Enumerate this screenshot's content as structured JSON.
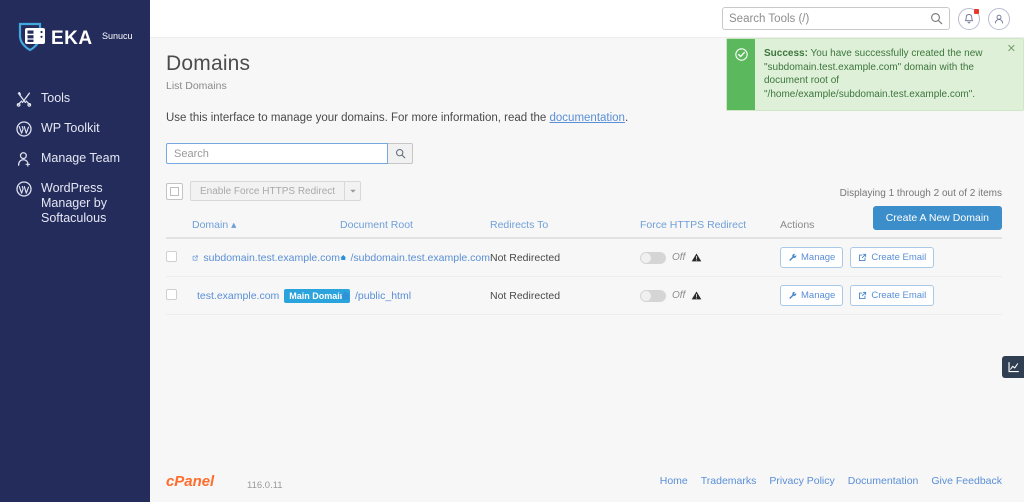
{
  "sidebar": {
    "logo": {
      "brand": "EKA",
      "suffix": "Sunucu",
      "icon": "shield-server-icon"
    },
    "items": [
      {
        "label": "Tools",
        "icon": "tools-icon"
      },
      {
        "label": "WP Toolkit",
        "icon": "wordpress-icon"
      },
      {
        "label": "Manage Team",
        "icon": "manage-team-icon"
      },
      {
        "label": "WordPress Manager by Softaculous",
        "icon": "wordpress-icon"
      }
    ]
  },
  "topbar": {
    "search_placeholder": "Search Tools (/)",
    "search_value": "",
    "search_icon": "search-icon",
    "notifications_icon": "bell-icon",
    "account_icon": "user-icon",
    "has_notification": true
  },
  "alert": {
    "icon": "check-circle-icon",
    "label": "Success:",
    "message": " You have successfully created the new \"subdomain.test.example.com\" domain with the document root of \"/home/example/subdomain.test.example.com\".",
    "close_icon": "close-icon"
  },
  "page": {
    "title": "Domains",
    "breadcrumb": "List Domains",
    "intro_text": "Use this interface to manage your domains. For more information, read the ",
    "intro_link": "documentation",
    "intro_suffix": "."
  },
  "toolbar": {
    "search_placeholder": "Search",
    "search_value": "",
    "search_button_icon": "search-icon",
    "select_all_checkbox": "select-all",
    "bulk_action_label": "Enable Force HTTPS Redirect",
    "bulk_caret_icon": "caret-down-icon",
    "count_text": "Displaying 1 through 2 out of 2 items",
    "create_button": "Create A New Domain"
  },
  "table": {
    "columns": [
      {
        "label": "Domain",
        "sorted": true,
        "sort_icon": "caret-up-icon"
      },
      {
        "label": "Document Root",
        "sorted": false
      },
      {
        "label": "Redirects To",
        "sorted": false
      },
      {
        "label": "Force HTTPS Redirect",
        "sorted": false
      },
      {
        "label": "Actions",
        "sorted": false
      }
    ],
    "rows": [
      {
        "domain": "subdomain.test.example.com",
        "domain_icon": "external-link-icon",
        "badge": "",
        "document_root": "/subdomain.test.example.com",
        "root_icon": "home-icon",
        "redirects_to": "Not Redirected",
        "https_state": "Off",
        "https_warning_icon": "warning-icon",
        "manage_label": "Manage",
        "manage_icon": "wrench-icon",
        "email_label": "Create Email",
        "email_icon": "external-link-icon"
      },
      {
        "domain": "test.example.com",
        "domain_icon": "external-link-icon",
        "badge": "Main Domain",
        "document_root": "/public_html",
        "root_icon": "home-icon",
        "redirects_to": "Not Redirected",
        "https_state": "Off",
        "https_warning_icon": "warning-icon",
        "manage_label": "Manage",
        "manage_icon": "wrench-icon",
        "email_label": "Create Email",
        "email_icon": "external-link-icon"
      }
    ]
  },
  "float_widget": {
    "icon": "statistics-chart-icon"
  },
  "footer": {
    "brand": "cPanel",
    "version": "116.0.11",
    "links": [
      {
        "label": "Home"
      },
      {
        "label": "Trademarks"
      },
      {
        "label": "Privacy Policy"
      },
      {
        "label": "Documentation"
      },
      {
        "label": "Give Feedback"
      }
    ]
  },
  "colors": {
    "sidebar_bg": "#242c5c",
    "accent_blue": "#5a8fd6",
    "primary_button": "#3c8ecb",
    "badge_blue": "#2ba3dd",
    "success_green": "#5cb85c",
    "success_bg": "#dff0d8",
    "cpanel_orange": "#ff6c2c"
  }
}
